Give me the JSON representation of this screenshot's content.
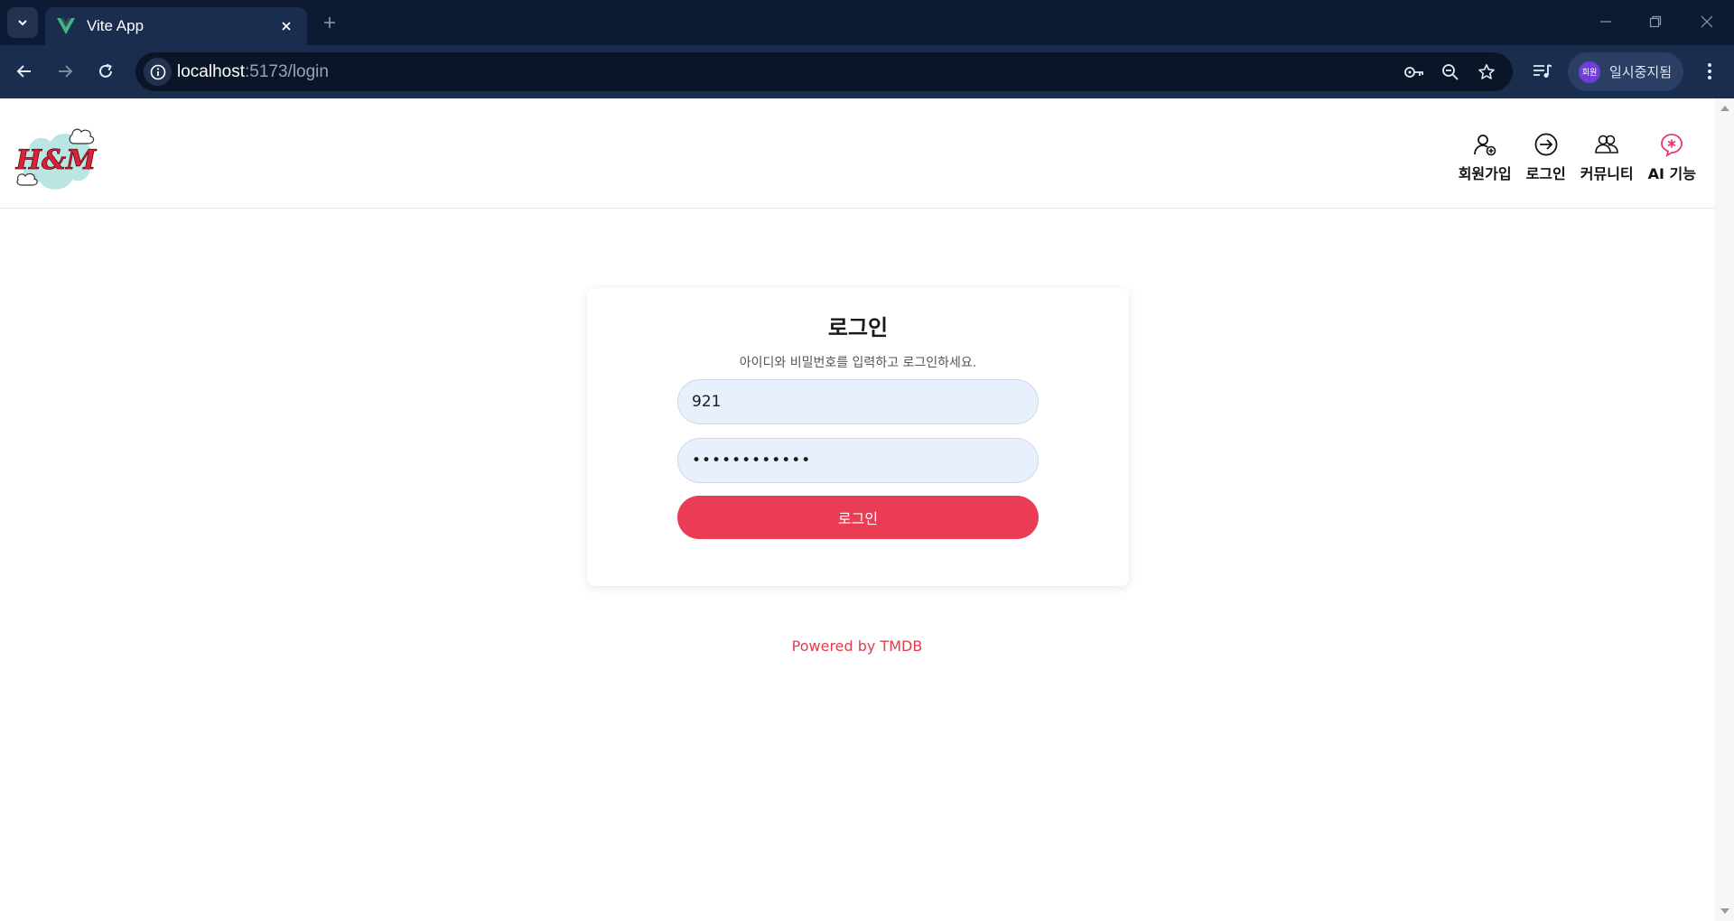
{
  "browser": {
    "tab_title": "Vite App",
    "url_host": "localhost",
    "url_rest": ":5173/login",
    "profile_avatar_text": "회원",
    "profile_label": "일시중지됨",
    "icons": [
      "tab-list-icon",
      "vue-favicon-icon",
      "close-icon",
      "plus-icon",
      "minimize-icon",
      "restore-icon",
      "window-close-icon",
      "back-icon",
      "forward-icon",
      "reload-icon",
      "info-icon",
      "key-icon",
      "zoom-out-icon",
      "star-icon",
      "media-queue-icon",
      "kebab-menu-icon"
    ]
  },
  "header": {
    "logo_text": "H&M",
    "nav": [
      {
        "label": "회원가입",
        "icon": "user-add-icon"
      },
      {
        "label": "로그인",
        "icon": "login-icon"
      },
      {
        "label": "커뮤니티",
        "icon": "community-icon"
      },
      {
        "label": "AI 기능",
        "icon": "ai-sparkle-icon"
      }
    ]
  },
  "login": {
    "title": "로그인",
    "subtitle": "아이디와 비밀번호를 입력하고 로그인하세요.",
    "username_value": "921",
    "password_masked": "••••••••••••",
    "submit_label": "로그인"
  },
  "footer": {
    "powered_by": "Powered by TMDB"
  },
  "colors": {
    "accent": "#ea3c54",
    "input_bg": "#e8f0fe",
    "chrome_dark": "#0c1a33",
    "chrome_toolbar": "#1b2d4f",
    "ai_icon": "#e83a6f"
  }
}
